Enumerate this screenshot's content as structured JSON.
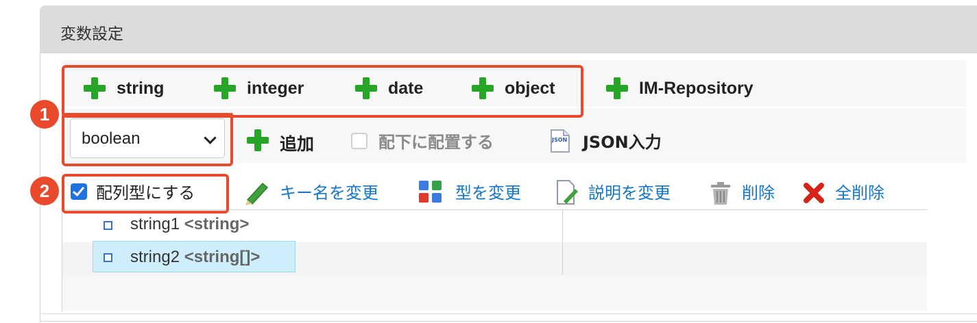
{
  "panel": {
    "title": "変数設定"
  },
  "toolbar_row1": {
    "buttons": [
      {
        "label": "string",
        "icon": "plus-icon"
      },
      {
        "label": "integer",
        "icon": "plus-icon"
      },
      {
        "label": "date",
        "icon": "plus-icon"
      },
      {
        "label": "object",
        "icon": "plus-icon"
      },
      {
        "label": "IM-Repository",
        "icon": "plus-icon"
      }
    ]
  },
  "toolbar_row2": {
    "type_select": {
      "value": "boolean"
    },
    "add_label": "追加",
    "place_under_label": "配下に配置する",
    "json_input_label": "JSON入力",
    "json_icon_text": "JSON"
  },
  "toolbar_row3": {
    "array_checkbox_label": "配列型にする",
    "array_checked": true,
    "rename_key_label": "キー名を変更",
    "change_type_label": "型を変更",
    "change_desc_label": "説明を変更",
    "delete_label": "削除",
    "delete_all_label": "全削除"
  },
  "callouts": [
    {
      "number": "1"
    },
    {
      "number": "2"
    }
  ],
  "tree": {
    "nodes": [
      {
        "name": "string1",
        "type": "<string>",
        "selected": false
      },
      {
        "name": "string2",
        "type": "<string[]>",
        "selected": true
      }
    ]
  },
  "colors": {
    "accent_green": "#27a527",
    "callout_red": "#e84a2b",
    "link_blue": "#1677c8",
    "checkbox_blue": "#1f72e0",
    "selection_bg": "#cfeefc"
  }
}
